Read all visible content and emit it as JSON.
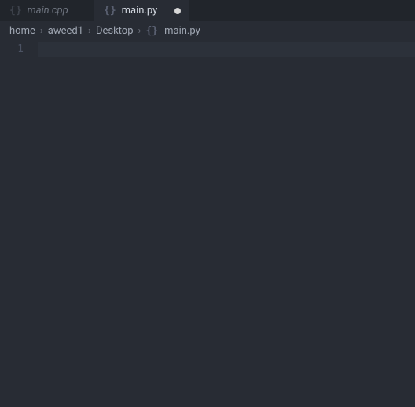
{
  "tabs": [
    {
      "label": "main.cpp",
      "active": false,
      "modified": false
    },
    {
      "label": "main.py",
      "active": true,
      "modified": true
    }
  ],
  "breadcrumb": {
    "segments": [
      "home",
      "aweed1",
      "Desktop"
    ],
    "file": "main.py"
  },
  "editor": {
    "line_numbers": [
      "1"
    ],
    "lines": [
      ""
    ]
  }
}
